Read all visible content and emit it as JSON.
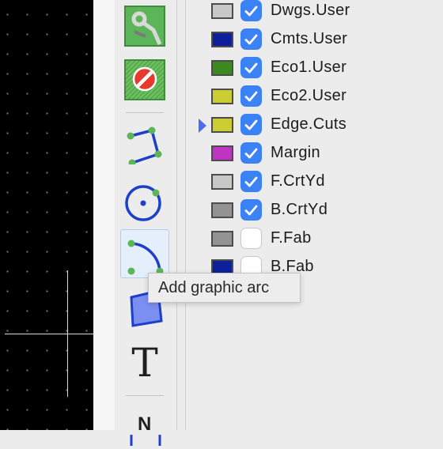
{
  "tooltip": "Add graphic arc",
  "toolbar": {
    "tools": [
      {
        "name": "local-ratsnest-tool",
        "icon": "ratsnest-icon"
      },
      {
        "name": "keepout-area-tool",
        "icon": "no-entry-icon"
      },
      {
        "name": "add-graphic-line-tool",
        "icon": "polyline-icon"
      },
      {
        "name": "add-graphic-circle-tool",
        "icon": "circle-icon"
      },
      {
        "name": "add-graphic-arc-tool",
        "icon": "arc-icon",
        "active": true
      },
      {
        "name": "add-graphic-polygon-tool",
        "icon": "polygon-icon"
      },
      {
        "name": "add-text-tool",
        "icon": "text-icon",
        "glyph": "T"
      },
      {
        "name": "add-dimension-tool",
        "icon": "dimension-icon",
        "glyph": "N"
      }
    ]
  },
  "layers": [
    {
      "name": "Dwgs.User",
      "color": "#c8c8c8",
      "visible": true,
      "current": false
    },
    {
      "name": "Cmts.User",
      "color": "#0e1f99",
      "visible": true,
      "current": false
    },
    {
      "name": "Eco1.User",
      "color": "#3a8a1f",
      "visible": true,
      "current": false
    },
    {
      "name": "Eco2.User",
      "color": "#cccc33",
      "visible": true,
      "current": false
    },
    {
      "name": "Edge.Cuts",
      "color": "#cccc33",
      "visible": true,
      "current": true
    },
    {
      "name": "Margin",
      "color": "#c034c4",
      "visible": true,
      "current": false
    },
    {
      "name": "F.CrtYd",
      "color": "#c8c8c8",
      "visible": true,
      "current": false
    },
    {
      "name": "B.CrtYd",
      "color": "#939393",
      "visible": true,
      "current": false
    },
    {
      "name": "F.Fab",
      "color": "#939393",
      "visible": false,
      "current": false
    },
    {
      "name": "B.Fab",
      "color": "#0e1f99",
      "visible": false,
      "current": false
    }
  ]
}
